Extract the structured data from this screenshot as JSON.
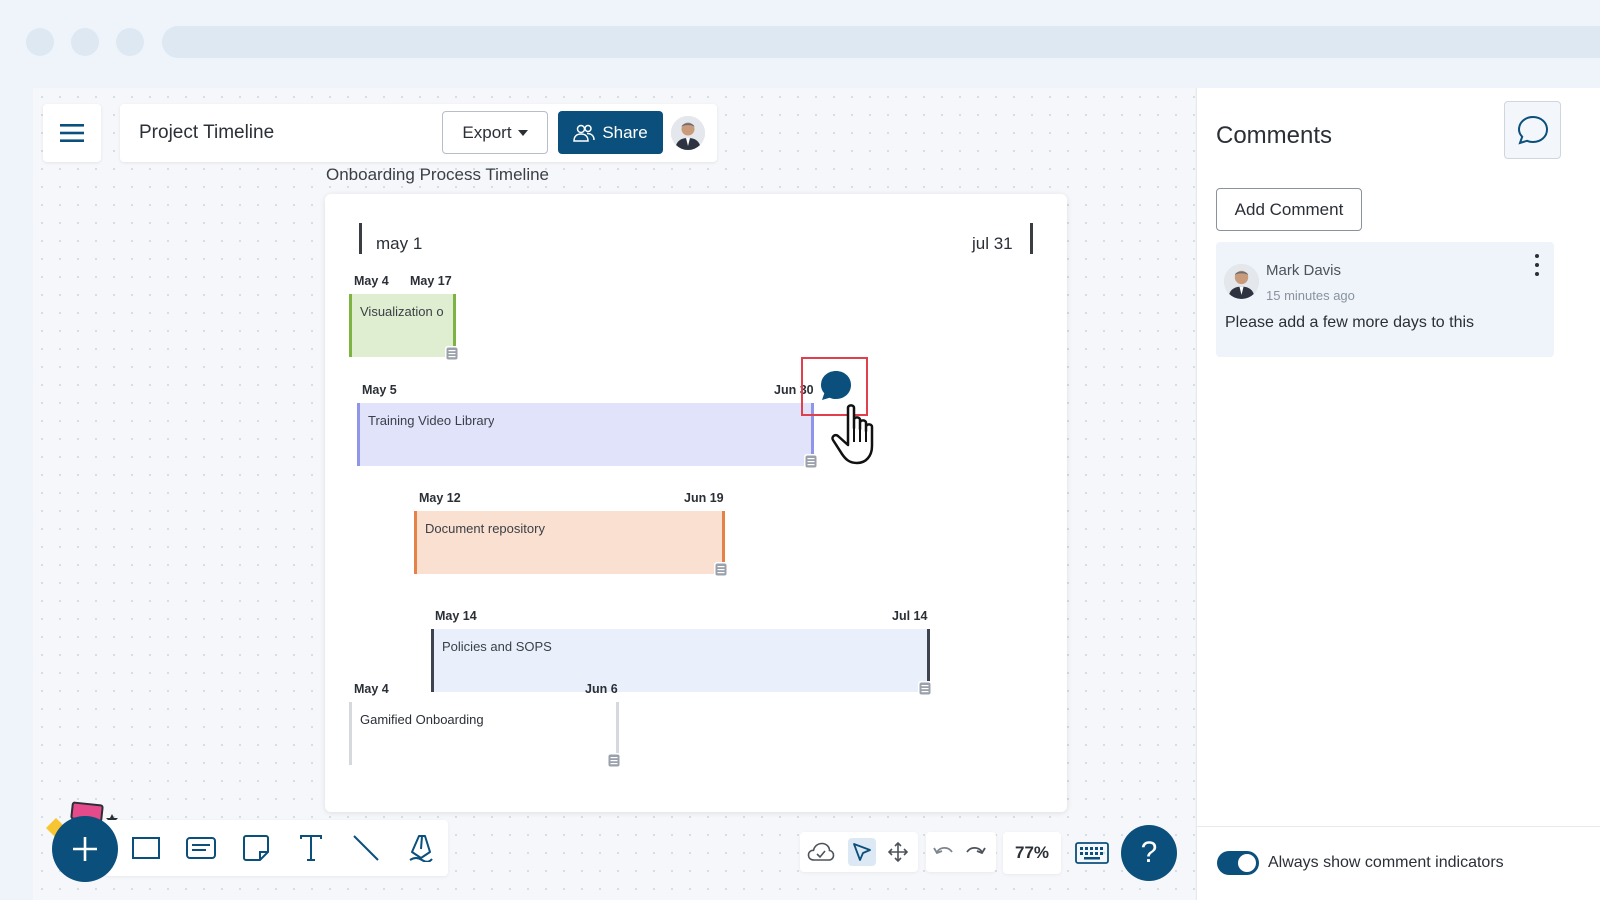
{
  "header": {
    "document_title": "Project Timeline",
    "export_label": "Export",
    "share_label": "Share"
  },
  "timeline": {
    "title": "Onboarding Process Timeline",
    "range_start": "may 1",
    "range_end": "jul 31",
    "tasks": [
      {
        "name": "Visualization o",
        "start": "May 4",
        "end": "May 17",
        "color": "#7cb342",
        "fill": "#dfeed0"
      },
      {
        "name": "Training Video Library",
        "start": "May 5",
        "end": "Jun 30",
        "color": "#8f95e8",
        "fill": "#e1e3fb"
      },
      {
        "name": "Document repository",
        "start": "May 12",
        "end": "Jun 19",
        "color": "#e5824a",
        "fill": "#f9e0d0"
      },
      {
        "name": "Policies and SOPS",
        "start": "May 14",
        "end": "Jul 14",
        "color": "#3d4450",
        "fill": "#eaf0fb"
      },
      {
        "name": "Gamified Onboarding",
        "start": "May 4",
        "end": "Jun 6",
        "color": "#d5d8dc",
        "fill": "#ffffff"
      }
    ]
  },
  "toolbar": {
    "zoom": "77%",
    "help": "?"
  },
  "comments_panel": {
    "title": "Comments",
    "add_comment_label": "Add Comment",
    "comments": [
      {
        "author": "Mark Davis",
        "time": "15 minutes ago",
        "text": "Please add a few more days to this"
      }
    ],
    "footer_toggle_label": "Always show comment indicators",
    "footer_toggle_on": true
  },
  "colors": {
    "brand": "#0b4f7c",
    "highlight": "#e0404e"
  }
}
